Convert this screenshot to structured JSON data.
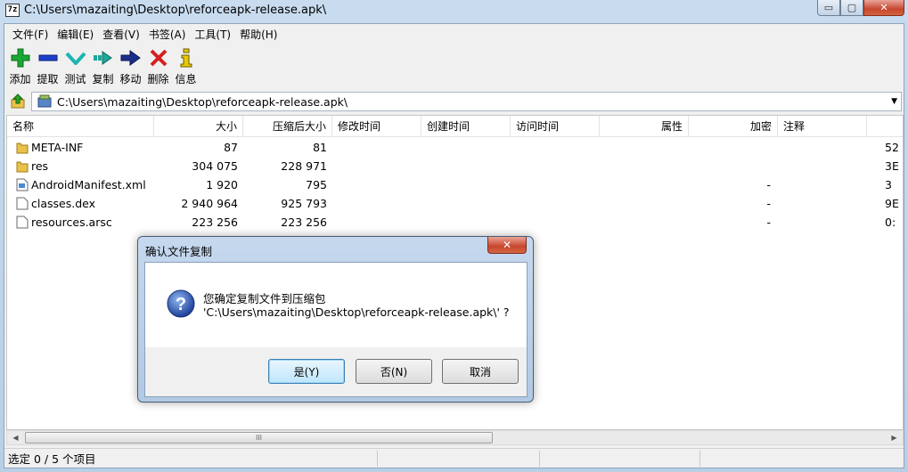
{
  "window": {
    "title": "C:\\Users\\mazaiting\\Desktop\\reforceapk-release.apk\\",
    "app_icon_text": "7z",
    "min_glyph": "▭",
    "max_glyph": "▢",
    "close_glyph": "✕"
  },
  "menu": [
    {
      "label": "文件(F)"
    },
    {
      "label": "编辑(E)"
    },
    {
      "label": "查看(V)"
    },
    {
      "label": "书签(A)"
    },
    {
      "label": "工具(T)"
    },
    {
      "label": "帮助(H)"
    }
  ],
  "toolbar": [
    {
      "label": "添加",
      "icon": "add-icon",
      "color": "#1aa832"
    },
    {
      "label": "提取",
      "icon": "extract-icon",
      "color": "#1e3fc8"
    },
    {
      "label": "测试",
      "icon": "test-icon",
      "color": "#1bb5b0"
    },
    {
      "label": "复制",
      "icon": "copy-icon",
      "color": "#1aa89a"
    },
    {
      "label": "移动",
      "icon": "move-icon",
      "color": "#1a2f8a"
    },
    {
      "label": "删除",
      "icon": "delete-icon",
      "color": "#d42020"
    },
    {
      "label": "信息",
      "icon": "info-icon",
      "color": "#e8c800"
    }
  ],
  "address": {
    "path": "C:\\Users\\mazaiting\\Desktop\\reforceapk-release.apk\\"
  },
  "columns": [
    "名称",
    "大小",
    "压缩后大小",
    "修改时间",
    "创建时间",
    "访问时间",
    "属性",
    "加密",
    "注释"
  ],
  "files": [
    {
      "name": "META-INF",
      "type": "folder",
      "size": "87",
      "packed": "81",
      "encrypted": "",
      "extra": "52"
    },
    {
      "name": "res",
      "type": "folder",
      "size": "304 075",
      "packed": "228 971",
      "encrypted": "",
      "extra": "3E"
    },
    {
      "name": "AndroidManifest.xml",
      "type": "xml",
      "size": "1 920",
      "packed": "795",
      "encrypted": "-",
      "extra": "3"
    },
    {
      "name": "classes.dex",
      "type": "file",
      "size": "2 940 964",
      "packed": "925 793",
      "encrypted": "-",
      "extra": "9E"
    },
    {
      "name": "resources.arsc",
      "type": "file",
      "size": "223 256",
      "packed": "223 256",
      "encrypted": "-",
      "extra": "0:"
    }
  ],
  "scrollbar": {
    "thumb_grip": "III"
  },
  "status": {
    "text": "选定 0 / 5 个项目"
  },
  "dialog": {
    "title": "确认文件复制",
    "line1": "您确定复制文件到压缩包",
    "line2": "'C:\\Users\\mazaiting\\Desktop\\reforceapk-release.apk\\' ?",
    "yes": "是(Y)",
    "no": "否(N)",
    "cancel": "取消",
    "close_glyph": "✕"
  }
}
